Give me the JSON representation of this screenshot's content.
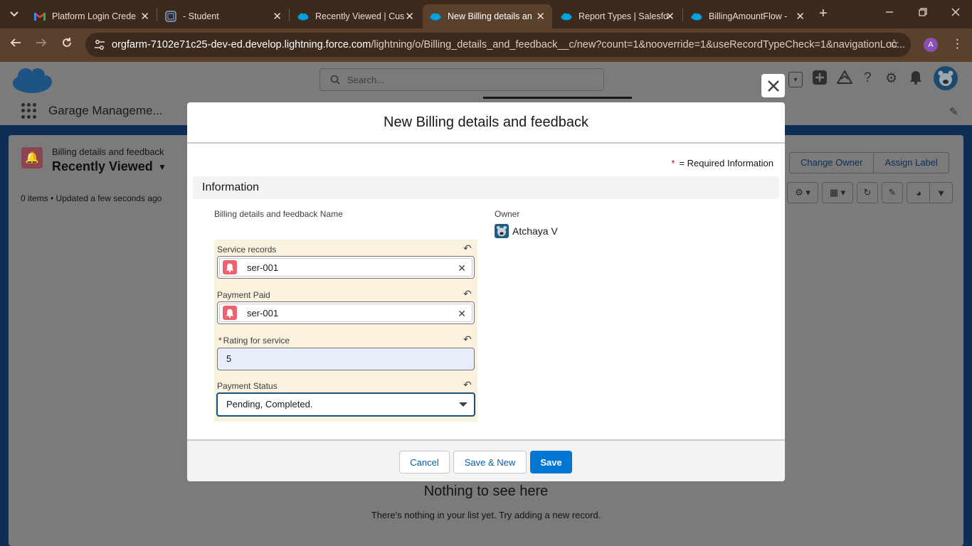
{
  "browser": {
    "tabs": [
      {
        "title": "Platform Login Crede",
        "icon": "gmail-icon"
      },
      {
        "title": "- Student",
        "icon": "student-icon"
      },
      {
        "title": "Recently Viewed | Cus",
        "icon": "salesforce-icon"
      },
      {
        "title": "New Billing details an",
        "icon": "salesforce-icon",
        "active": true
      },
      {
        "title": "Report Types | Salesfo",
        "icon": "salesforce-icon"
      },
      {
        "title": "BillingAmountFlow - ",
        "icon": "salesforce-icon"
      }
    ],
    "url_host": "orgfarm-7102e71c25-dev-ed.develop.lightning.force.com",
    "url_path": "/lightning/o/Billing_details_and_feedback__c/new?count=1&nooverride=1&useRecordTypeCheck=1&navigationLoc...",
    "profile_initial": "A"
  },
  "sf": {
    "search_placeholder": "Search...",
    "app_name": "Garage Manageme...",
    "list": {
      "object_label": "Billing details and feedback",
      "view_name": "Recently Viewed",
      "meta": "0 items • Updated a few seconds ago",
      "buttons": [
        "Change Owner",
        "Assign Label"
      ]
    },
    "empty": {
      "title": "Nothing to see here",
      "message": "There's nothing in your list yet. Try adding a new record."
    }
  },
  "modal": {
    "title": "New Billing details and feedback",
    "required_info_star": "*",
    "required_info": "= Required Information",
    "section_title": "Information",
    "fields": {
      "name_label": "Billing details and feedback Name",
      "owner_label": "Owner",
      "owner_value": "Atchaya V",
      "service_records_label": "Service records",
      "service_records_value": "ser-001",
      "payment_paid_label": "Payment Paid",
      "payment_paid_value": "ser-001",
      "rating_required": "*",
      "rating_label": "Rating for service",
      "rating_value": "5",
      "payment_status_label": "Payment Status",
      "payment_status_value": "Pending, Completed."
    },
    "buttons": {
      "cancel": "Cancel",
      "save_new": "Save & New",
      "save": "Save"
    }
  },
  "colors": {
    "brand_button": "#0176d3",
    "edited_highlight": "#faf1de",
    "lookup_icon": "#f0616e"
  }
}
